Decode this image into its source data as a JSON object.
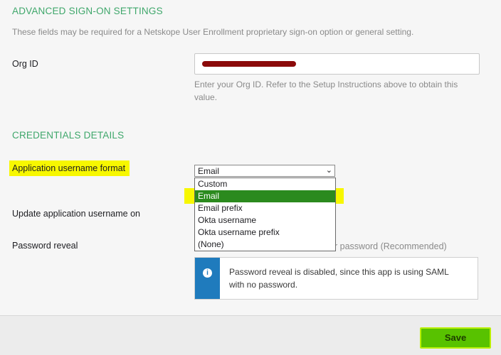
{
  "advanced": {
    "title": "ADVANCED SIGN-ON SETTINGS",
    "description": "These fields may be required for a Netskope User Enrollment proprietary sign-on option or general setting.",
    "org_id_label": "Org ID",
    "org_id_value": "",
    "org_id_help": "Enter your Org ID. Refer to the Setup Instructions above to obtain this value."
  },
  "credentials": {
    "title": "CREDENTIALS DETAILS",
    "username_format_label": "Application username format",
    "username_format_value": "Email",
    "options": [
      "Custom",
      "Email",
      "Email prefix",
      "Okta username",
      "Okta username prefix",
      "(None)"
    ],
    "selected_index": 1,
    "update_label": "Update application username on",
    "password_reveal_label": "Password reveal",
    "password_reveal_option_fragment": "r password (Recommended)",
    "info_text": "Password reveal is disabled, since this app is using SAML with no password."
  },
  "footer": {
    "save_label": "Save"
  },
  "colors": {
    "accent": "#3fa76b",
    "info": "#1f7bbd",
    "save": "#58c200",
    "highlight": "#f7f700"
  }
}
